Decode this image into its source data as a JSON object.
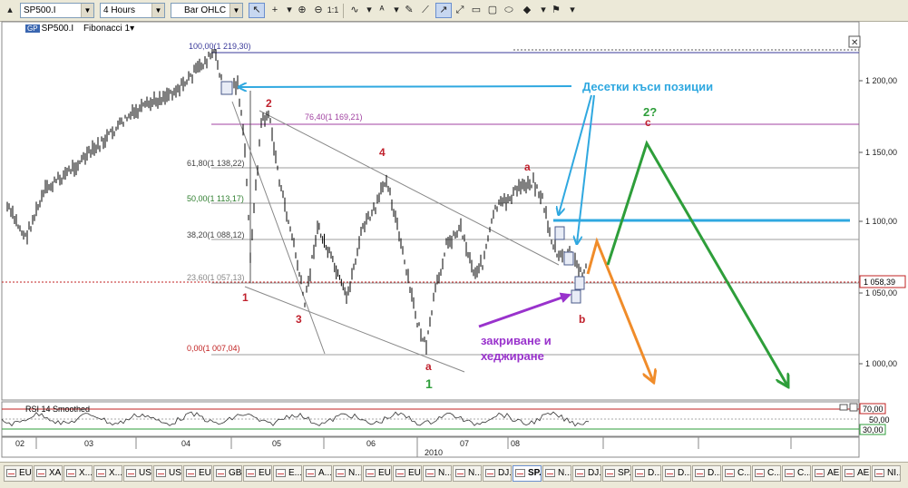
{
  "toolbar": {
    "symbol_value": "SP500.I",
    "timeframe_value": "4 Hours",
    "chart_type_value": "Bar OHLC",
    "zoom_label": "1:1"
  },
  "legend": {
    "symbol_badge": "GP",
    "symbol": "SP500.I",
    "indicator": "Fibonacci 1"
  },
  "fib_levels": [
    {
      "label": "100,00(1 219,30)"
    },
    {
      "label": "76,40(1 169,21)"
    },
    {
      "label": "61,80(1 138,22)"
    },
    {
      "label": "50,00(1 113,17)"
    },
    {
      "label": "38,20(1 088,12)"
    },
    {
      "label": "23,60(1 057,13)"
    },
    {
      "label": "0,00(1 007,04)"
    }
  ],
  "price_axis": {
    "ticks": [
      "1 200,00",
      "1 150,00",
      "1 100,00",
      "1 050,00",
      "1 000,00"
    ],
    "current_price": "1 058,39"
  },
  "rsi": {
    "label": "RSI 14 Smoothed",
    "ticks": [
      "70,00",
      "50,00",
      "30,00"
    ]
  },
  "time_axis": {
    "labels": [
      "02",
      "03",
      "04",
      "05",
      "06",
      "07",
      "08"
    ],
    "year": "2010"
  },
  "annotations": {
    "short_positions": "Десетки къси позиции",
    "closing_hedging_line1": "закриване и",
    "closing_hedging_line2": "хеджиране",
    "wave_1": "1",
    "wave_2": "2",
    "wave_3": "3",
    "wave_4": "4",
    "wave_a_top": "a",
    "wave_a_bottom": "a",
    "wave_1_green": "1",
    "wave_b": "b",
    "wave_c": "c",
    "wave_2q": "2?"
  },
  "tabs": [
    {
      "label": "EU..."
    },
    {
      "label": "XA..."
    },
    {
      "label": "X..."
    },
    {
      "label": "X..."
    },
    {
      "label": "US..."
    },
    {
      "label": "US..."
    },
    {
      "label": "EU..."
    },
    {
      "label": "GB..."
    },
    {
      "label": "EU..."
    },
    {
      "label": "E..."
    },
    {
      "label": "A..."
    },
    {
      "label": "N..."
    },
    {
      "label": "EU..."
    },
    {
      "label": "EU..."
    },
    {
      "label": "N..."
    },
    {
      "label": "N..."
    },
    {
      "label": "DJ..."
    },
    {
      "label": "SP...",
      "active": true
    },
    {
      "label": "N..."
    },
    {
      "label": "DJ..."
    },
    {
      "label": "SP..."
    },
    {
      "label": "D..."
    },
    {
      "label": "D..."
    },
    {
      "label": "D..."
    },
    {
      "label": "C..."
    },
    {
      "label": "C..."
    },
    {
      "label": "C..."
    },
    {
      "label": "AE..."
    },
    {
      "label": "AE..."
    },
    {
      "label": "NI..."
    }
  ],
  "colors": {
    "price_bars": "#000000",
    "fib_line": "#9c9c9c",
    "fib_76": "#a040a0",
    "short_line": "#2fa8e0",
    "green_path": "#2e9e3a",
    "orange_path": "#f08c2a",
    "purple_arrow": "#9932cc",
    "wave_labels": "#c0202c"
  }
}
